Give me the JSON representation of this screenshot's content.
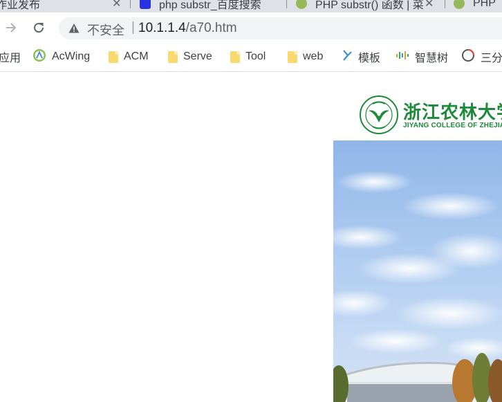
{
  "tabs": [
    {
      "title": "作业发布",
      "favicon_color": "#dee1e6"
    },
    {
      "title": "php substr_百度搜索",
      "favicon_color": "#2932e1"
    },
    {
      "title": "PHP substr() 函数 | 菜",
      "favicon_color": "#96b85a"
    },
    {
      "title": "PHP",
      "favicon_color": "#96b85a"
    }
  ],
  "tab_close_glyph": "✕",
  "toolbar": {
    "back_icon": "arrow-left-icon",
    "forward_icon": "arrow-right-icon",
    "reload_icon": "reload-icon",
    "security_label": "不安全",
    "separator": "|",
    "url_host": "10.1.1.4",
    "url_path": "/a70.htm"
  },
  "bookmarks": [
    {
      "label": "应用",
      "icon": "apps-icon"
    },
    {
      "label": "AcWing",
      "icon": "acwing-icon"
    },
    {
      "label": "ACM",
      "icon": "folder-icon"
    },
    {
      "label": "Serve",
      "icon": "folder-icon"
    },
    {
      "label": "Tool",
      "icon": "folder-icon"
    },
    {
      "label": "web",
      "icon": "folder-icon"
    },
    {
      "label": "模板",
      "icon": "template-icon"
    },
    {
      "label": "智慧树",
      "icon": "zhihuishu-icon"
    },
    {
      "label": "三分",
      "icon": "circle-icon"
    }
  ],
  "page": {
    "logo_title": "浙江农林大学",
    "logo_subtitle": "JIYANG COLLEGE OF ZHEJIANG A&F UNIVERSITY",
    "brand_color": "#1d8a3a"
  }
}
